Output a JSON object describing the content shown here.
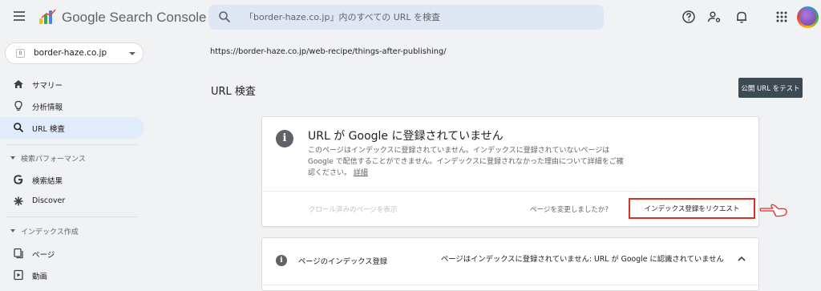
{
  "header": {
    "app_title": "Google Search Console",
    "search_placeholder": "「border-haze.co.jp」内のすべての URL を検査"
  },
  "sidebar": {
    "property": "border-haze.co.jp",
    "items_top": [
      {
        "label": "サマリー",
        "icon": "home-icon"
      },
      {
        "label": "分析情報",
        "icon": "lightbulb-icon"
      },
      {
        "label": "URL 検査",
        "icon": "search-icon",
        "active": true
      }
    ],
    "section_performance": "検索パフォーマンス",
    "items_performance": [
      {
        "label": "検索結果",
        "icon": "google-g-icon"
      },
      {
        "label": "Discover",
        "icon": "asterisk-icon"
      }
    ],
    "section_index": "インデックス作成",
    "items_index": [
      {
        "label": "ページ",
        "icon": "pages-icon"
      },
      {
        "label": "動画",
        "icon": "video-icon"
      }
    ]
  },
  "main": {
    "inspected_url": "https://border-haze.co.jp/web-recipe/things-after-publishing/",
    "page_title": "URL 検査",
    "test_button": "公開 URL をテスト",
    "status_card": {
      "title": "URL が Google に登録されていません",
      "description": "このページはインデックスに登録されていません。インデックスに登録されていないページは Google で配信することができません。インデックスに登録されなかった理由について詳細をご確認ください。",
      "details_link": "詳細",
      "crawled_link": "クロール済みのページを表示",
      "changed_question": "ページを変更しましたか？",
      "request_button": "インデックス登録をリクエスト"
    },
    "index_card": {
      "label": "ページのインデックス登録",
      "status": "ページはインデックスに登録されていません: URL が Google に認識されていません"
    }
  },
  "colors": {
    "highlight_border": "#d93025",
    "active_nav_bg": "#e0ebfc",
    "test_button_bg": "#3c4a53",
    "search_bg": "#dfe7f4"
  }
}
